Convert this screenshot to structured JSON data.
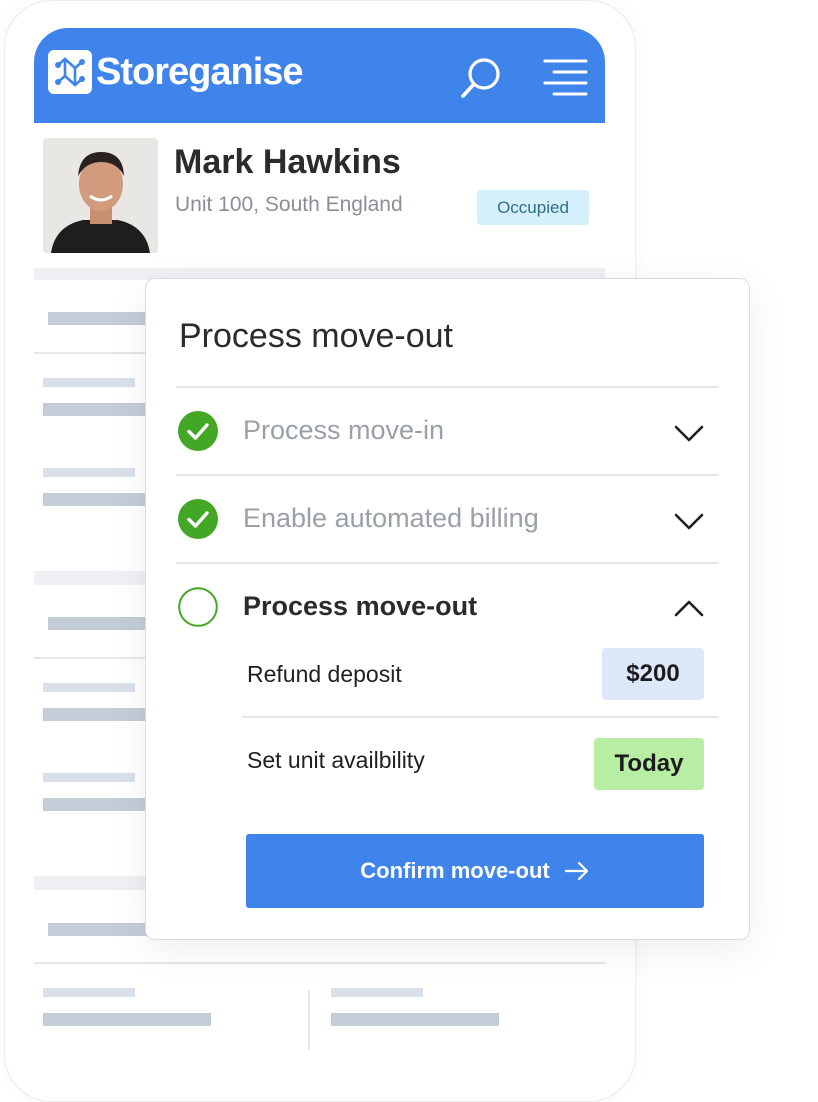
{
  "app": {
    "name": "Storeganise",
    "accent": "#3f84ea"
  },
  "header": {
    "search_icon": "search-icon",
    "menu_icon": "menu-icon"
  },
  "profile": {
    "name": "Mark Hawkins",
    "unit": "Unit 100, South England",
    "status": "Occupied",
    "status_color": "#d5f0fb"
  },
  "card": {
    "title": "Process move-out",
    "steps": [
      {
        "label": "Process move-in",
        "done": true,
        "expanded": false
      },
      {
        "label": "Enable automated billing",
        "done": true,
        "expanded": false
      },
      {
        "label": "Process move-out",
        "done": false,
        "expanded": true
      }
    ],
    "details": [
      {
        "label": "Refund deposit",
        "value": "$200",
        "color": "#dde8fb"
      },
      {
        "label": "Set unit availbility",
        "value": "Today",
        "color": "#b8eda4"
      }
    ],
    "confirm_label": "Confirm move-out",
    "confirm_icon": "arrow-right-icon"
  }
}
